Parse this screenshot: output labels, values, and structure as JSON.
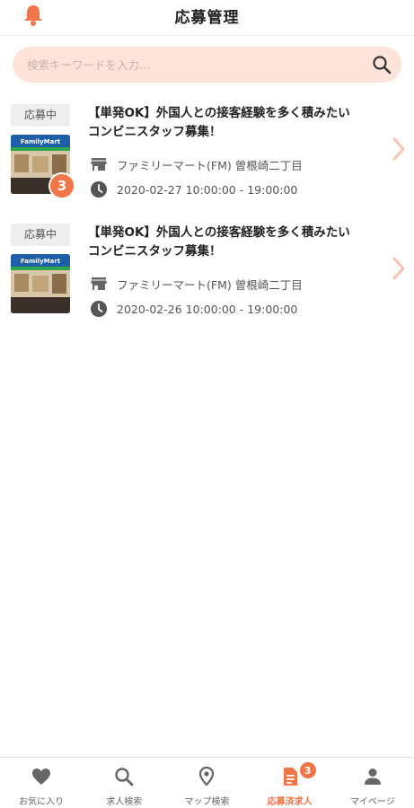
{
  "header": {
    "title": "応募管理"
  },
  "search": {
    "placeholder": "検索キーワードを入力..."
  },
  "applications": [
    {
      "status": "応募中",
      "title": "【単発OK】外国人との接客経験を多く積みたいコンビニスタッフ募集！",
      "store": "ファミリーマート(FM) 曽根崎二丁目",
      "datetime": "2020-02-27 10:00:00 - 19:00:00",
      "thumb_sign": "FamilyMart",
      "badge": "3"
    },
    {
      "status": "応募中",
      "title": "【単発OK】外国人との接客経験を多く積みたいコンビニスタッフ募集！",
      "store": "ファミリーマート(FM) 曽根崎二丁目",
      "datetime": "2020-02-26 10:00:00 - 19:00:00",
      "thumb_sign": "FamilyMart"
    }
  ],
  "tabbar": {
    "tabs": [
      {
        "label": "お気に入り",
        "icon": "heart-icon"
      },
      {
        "label": "求人検索",
        "icon": "search-icon"
      },
      {
        "label": "マップ検索",
        "icon": "map-pin-icon"
      },
      {
        "label": "応募済求人",
        "icon": "document-icon",
        "active": true,
        "badge": "3"
      },
      {
        "label": "マイページ",
        "icon": "person-icon"
      }
    ]
  },
  "colors": {
    "accent": "#f0764a",
    "search_bg": "#fde3d9",
    "chevron": "#f7c4b2"
  }
}
